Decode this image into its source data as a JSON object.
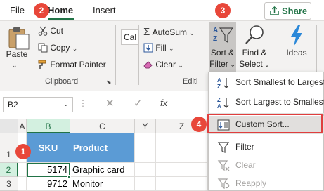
{
  "tabs": [
    {
      "label": "File"
    },
    {
      "label": "Home"
    },
    {
      "label": "Insert"
    }
  ],
  "share_label": "Share",
  "ribbon": {
    "clipboard": {
      "paste": "Paste",
      "cut": "Cut",
      "copy": "Copy",
      "format_painter": "Format Painter",
      "group_label": "Clipboard"
    },
    "font_box_text": "Cal",
    "editing": {
      "autosum": "AutoSum",
      "fill": "Fill",
      "clear": "Clear",
      "group_label": "Editi",
      "sort_filter_line1": "Sort &",
      "sort_filter_line2": "Filter",
      "find_select_line1": "Find &",
      "find_select_line2": "Select"
    },
    "ideas": "Ideas"
  },
  "formula_bar": {
    "name_box": "B2",
    "fx": "fx"
  },
  "grid": {
    "columns": [
      "A",
      "B",
      "C",
      "Y",
      "Z"
    ],
    "rows": [
      "1",
      "2",
      "3"
    ],
    "header_row": [
      "SKU",
      "Product"
    ],
    "data": [
      [
        "5174",
        "Graphic card"
      ],
      [
        "9712",
        "Monitor"
      ]
    ]
  },
  "menu": {
    "items": [
      {
        "label": "Sort Smallest to Largest",
        "icon": "sort-ascending-icon",
        "disabled": false
      },
      {
        "label": "Sort Largest to Smallest",
        "icon": "sort-descending-icon",
        "disabled": false
      },
      {
        "label": "Custom Sort...",
        "icon": "custom-sort-icon",
        "disabled": false
      },
      {
        "label": "Filter",
        "icon": "filter-icon",
        "disabled": false
      },
      {
        "label": "Clear",
        "icon": "clear-filter-icon",
        "disabled": true
      },
      {
        "label": "Reapply",
        "icon": "reapply-icon",
        "disabled": true
      }
    ]
  },
  "badges": [
    "1",
    "2",
    "3",
    "4"
  ],
  "colors": {
    "excel_green": "#217346",
    "header_fill": "#5b9bd5",
    "badge": "#e8473a",
    "highlight_border": "#e03e3e"
  }
}
